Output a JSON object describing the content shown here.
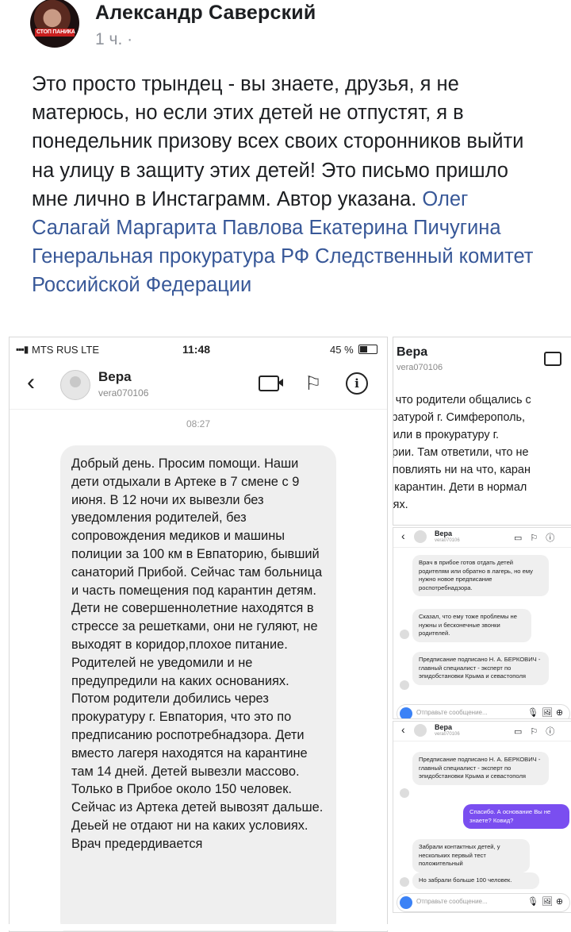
{
  "post": {
    "author": "Александр Саверский",
    "time": "1 ч. ·",
    "avatar_caption": "СТОП ПАНИКА",
    "text": "Это просто трындец - вы знаете, друзья, я не матерюсь, но если этих детей не отпустят, я в понедельник призову всех своих сторонников выйти на улицу в защиту этих детей! Это письмо пришло мне лично в Инстаграмм. Автор указана. ",
    "tags": "Олег Салагай Маргарита Павлова Екатерина Пичугина Генеральная прокуратура РФ Следственный комитет Российской Федерации"
  },
  "screenshot_main": {
    "status": {
      "signal": "▪▪▪▮",
      "carrier": "MTS RUS  LTE",
      "time": "11:48",
      "battery": "45 %"
    },
    "contact_name": "Вера",
    "contact_user": "vera070106",
    "back_icon": "‹",
    "flag_icon": "⚐",
    "info_icon": "i",
    "message_time": "08:27",
    "message": "Добрый день. Просим помощи. Наши дети отдыхали в Артеке в 7 смене с 9 июня. В 12 ночи их вывезли без уведомления родителей, без сопровождения медиков и машины полиции за 100 км в Евпаторию, бывший санаторий Прибой. Сейчас там больница и часть помещения под карантин детям. Дети не совершеннолетние находятся в стрессе за решетками, они не гуляют, не выходят в коридор,плохое питание. Родителей не уведомили и не предупредили на каких основаниях. Потом родители добились через прокуратуру г. Евпатория, что это по предписанию роспотребнадзора. Дети вместо лагеря находятся на карантине там 14 дней. Детей вывезли массово. Только в Прибое около 150 человек. Сейчас из Артека детей вывозят дальше. Деьей не отдают ни на каких условиях. Врач предердивается"
  },
  "screenshot_top": {
    "contact_name": "Вера",
    "contact_user": "vera070106",
    "lines": [
      "аю, что родители общались с",
      "окуратурой г. Симферополь,",
      "равили в прокуратуру г.",
      "атории. Там ответили, что не",
      "гут повлиять ни на что, каран",
      "сть карантин. Дети в нормал",
      "овиях."
    ]
  },
  "mini1": {
    "header": {
      "back": "‹",
      "name": "Вера",
      "user": "vera070106",
      "icons": "▭⚐ⓘ"
    },
    "messages": [
      "Врач в прибое готов отдать детей родителям или обратно в лагерь, но ему нужно новое предписание роспотребнадзора.",
      "Сказал, что ему тоже проблемы не нужны и бесконечные звонки родителей.",
      "Предписание подписано Н. А. БЕРКОВИЧ - главный специалист - эксперт по эпидобстановки Крыма и севастополя"
    ],
    "input_placeholder": "Отправьте сообщение...",
    "input_icons": "🎙🖼⊕"
  },
  "mini2": {
    "header": {
      "back": "‹",
      "name": "Вера",
      "user": "vera070106",
      "icons": "▭⚐ⓘ"
    },
    "messages": [
      "Предписание подписано Н. А. БЕРКОВИЧ - главный специалист - эксперт по эпидобстановки Крыма и севастополя",
      "Спасибо. А основание Вы не знаете? Ковид?",
      "Забрали контактных детей, у нескольких первый тест положительный",
      "Но забрали больше 100 человек."
    ],
    "input_placeholder": "Отправьте сообщение...",
    "input_icons": "🎙🖼⊕"
  },
  "colors": {
    "link": "#385898",
    "outgoing_bubble": "#7a4ef0",
    "incoming_bubble": "#efefef"
  }
}
